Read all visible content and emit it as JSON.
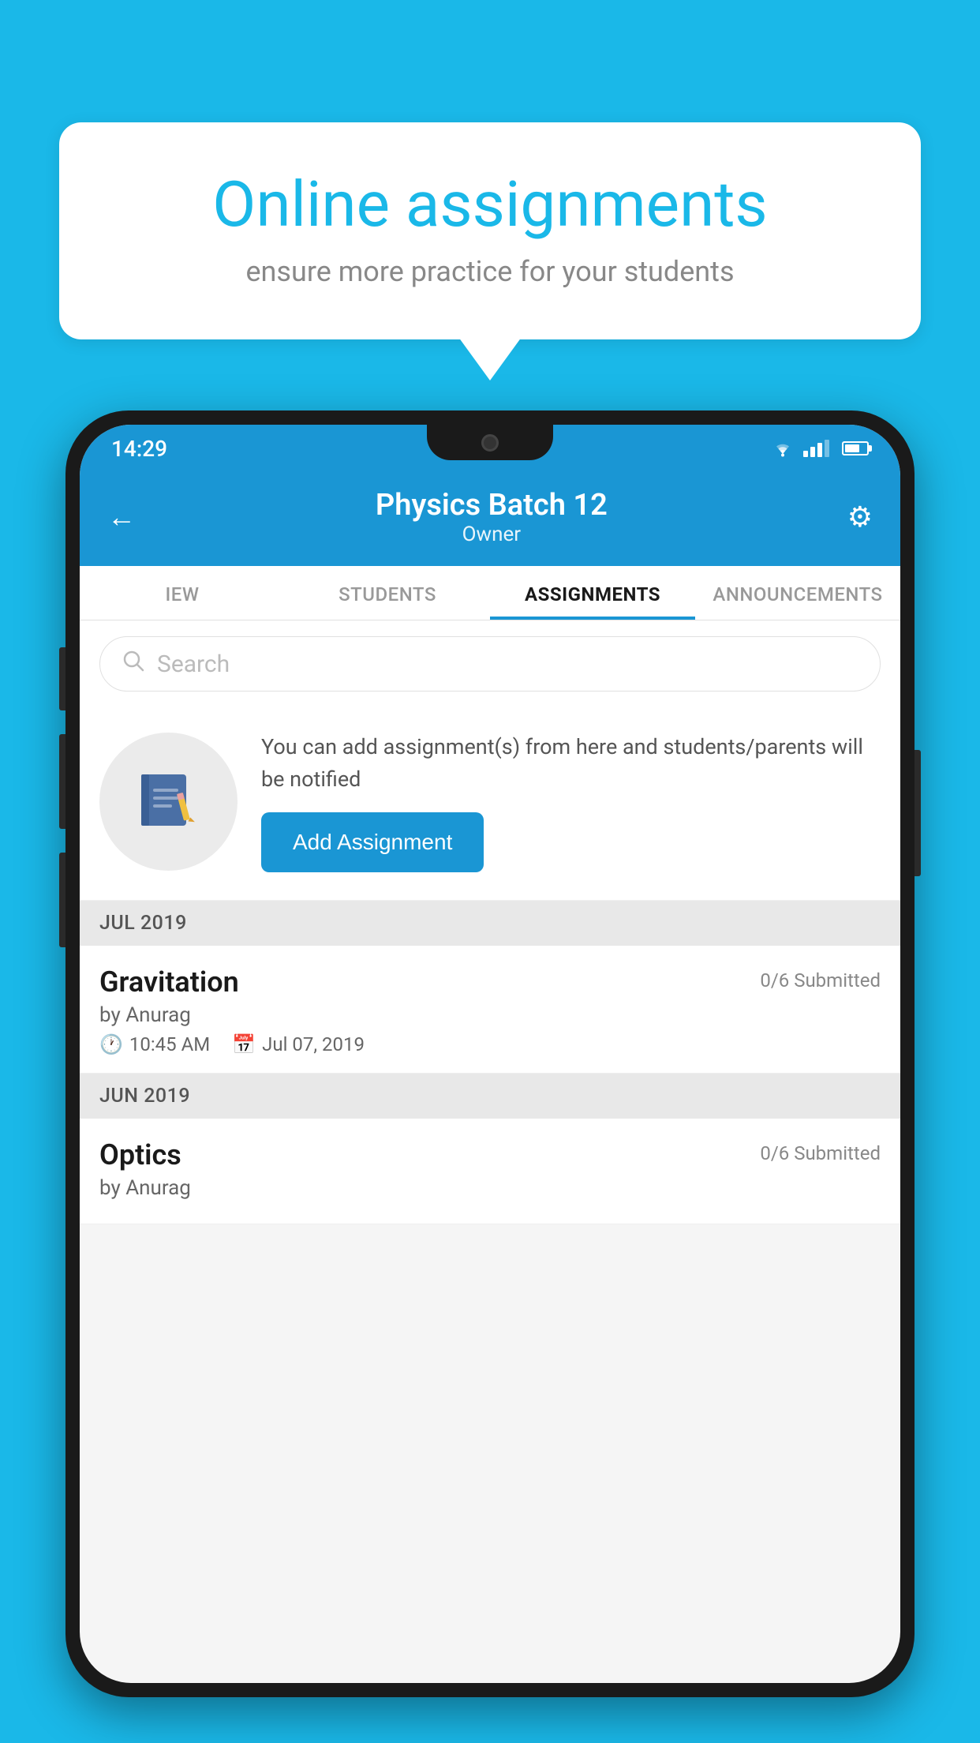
{
  "background": {
    "color": "#1ab8e8"
  },
  "speech_bubble": {
    "title": "Online assignments",
    "subtitle": "ensure more practice for your students"
  },
  "status_bar": {
    "time": "14:29"
  },
  "app_header": {
    "title": "Physics Batch 12",
    "subtitle": "Owner",
    "back_label": "←",
    "settings_label": "⚙"
  },
  "tabs": [
    {
      "label": "IEW",
      "active": false
    },
    {
      "label": "STUDENTS",
      "active": false
    },
    {
      "label": "ASSIGNMENTS",
      "active": true
    },
    {
      "label": "ANNOUNCEMENTS",
      "active": false
    }
  ],
  "search": {
    "placeholder": "Search"
  },
  "add_assignment_section": {
    "description": "You can add assignment(s) from here and students/parents will be notified",
    "button_label": "Add Assignment"
  },
  "sections": [
    {
      "header": "JUL 2019",
      "assignments": [
        {
          "name": "Gravitation",
          "submitted": "0/6 Submitted",
          "by": "by Anurag",
          "time": "10:45 AM",
          "date": "Jul 07, 2019"
        }
      ]
    },
    {
      "header": "JUN 2019",
      "assignments": [
        {
          "name": "Optics",
          "submitted": "0/6 Submitted",
          "by": "by Anurag",
          "time": "",
          "date": ""
        }
      ]
    }
  ]
}
